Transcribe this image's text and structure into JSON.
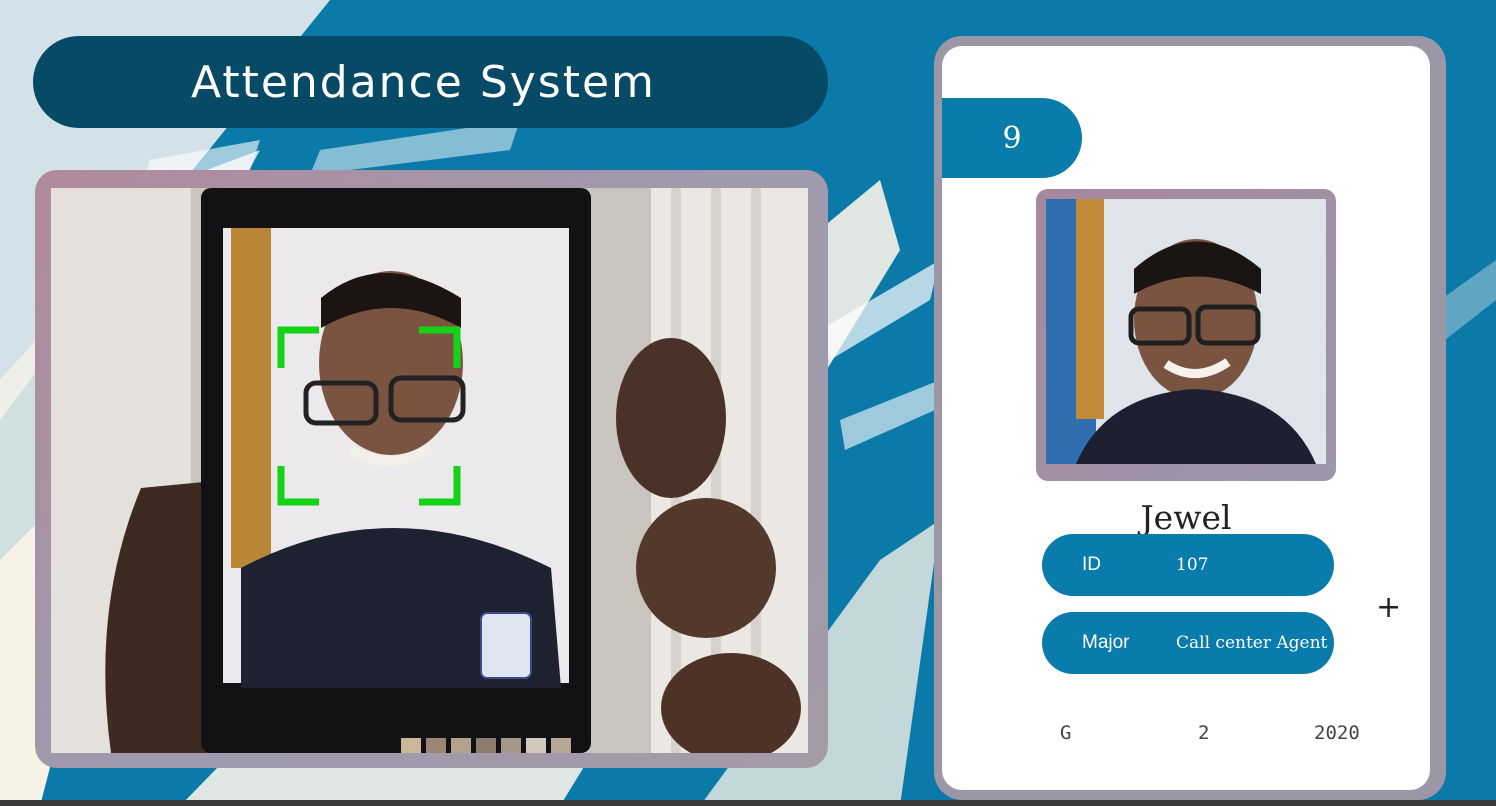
{
  "app": {
    "title": "Attendance System"
  },
  "camera": {
    "face_box_color": "#16d216"
  },
  "student": {
    "total_attendance": "9",
    "name": "Jewel",
    "id_label": "ID",
    "id_value": "107",
    "major_label": "Major",
    "major_value": "Call center Agent",
    "standing": "G",
    "year": "2",
    "starting_year": "2020"
  },
  "icons": {
    "plus": "+"
  },
  "colors": {
    "accent": "#0a7cab",
    "title_bg": "#064a66",
    "background": "#0b7aa8"
  }
}
